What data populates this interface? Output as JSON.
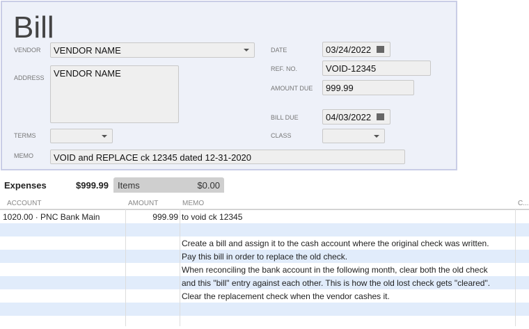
{
  "form": {
    "title": "Bill",
    "vendor_label": "VENDOR",
    "vendor": "VENDOR NAME",
    "address_label": "ADDRESS",
    "address": "VENDOR NAME",
    "terms_label": "TERMS",
    "memo_label": "MEMO",
    "memo": "VOID and REPLACE ck 12345 dated 12-31-2020",
    "date_label": "DATE",
    "date": "03/24/2022",
    "ref_label": "REF. NO.",
    "ref": "VOID-12345",
    "amount_label": "AMOUNT DUE",
    "amount": "999.99",
    "billdue_label": "BILL DUE",
    "billdue": "04/03/2022",
    "class_label": "CLASS"
  },
  "tabs": [
    {
      "label": "Expenses",
      "amount": "$999.99"
    },
    {
      "label": "Items",
      "amount": "$0.00"
    }
  ],
  "columns": [
    "ACCOUNT",
    "AMOUNT",
    "MEMO",
    "C..."
  ],
  "rows": [
    {
      "account": "1020.00 · PNC Bank Main",
      "amount": "999.99",
      "memo": "to void ck 12345"
    },
    {
      "account": "",
      "amount": "",
      "memo": ""
    },
    {
      "account": "",
      "amount": "",
      "memo": "Create a bill and assign it to the cash account where the original check was written."
    },
    {
      "account": "",
      "amount": "",
      "memo": "Pay this bill in order to replace the old check."
    },
    {
      "account": "",
      "amount": "",
      "memo": "When reconciling the bank account in the following month, clear both the old check"
    },
    {
      "account": "",
      "amount": "",
      "memo": "and this \"bill\" entry against each other. This is how the old lost check gets \"cleared\"."
    },
    {
      "account": "",
      "amount": "",
      "memo": " Clear the replacement check when the vendor cashes it."
    },
    {
      "account": "",
      "amount": "",
      "memo": ""
    },
    {
      "account": "",
      "amount": "",
      "memo": ""
    }
  ]
}
